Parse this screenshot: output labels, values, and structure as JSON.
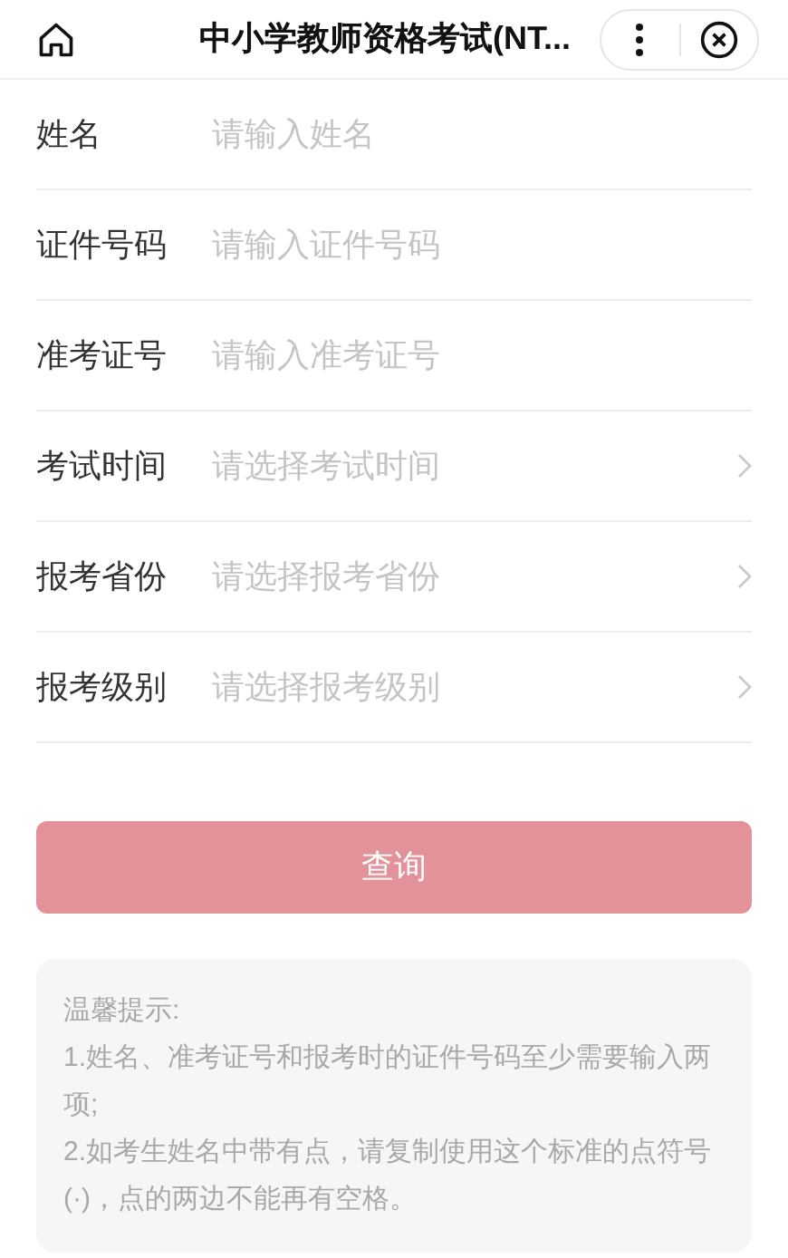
{
  "header": {
    "title": "中小学教师资格考试(NT..."
  },
  "fields": [
    {
      "kind": "input",
      "label": "姓名",
      "placeholder": "请输入姓名"
    },
    {
      "kind": "input",
      "label": "证件号码",
      "placeholder": "请输入证件号码"
    },
    {
      "kind": "input",
      "label": "准考证号",
      "placeholder": "请输入准考证号"
    },
    {
      "kind": "select",
      "label": "考试时间",
      "placeholder": "请选择考试时间"
    },
    {
      "kind": "select",
      "label": "报考省份",
      "placeholder": "请选择报考省份"
    },
    {
      "kind": "select",
      "label": "报考级别",
      "placeholder": "请选择报考级别"
    }
  ],
  "submit": {
    "label": "查询",
    "disabled": true
  },
  "notice": {
    "lines": [
      "温馨提示:",
      "1.姓名、准考证号和报考时的证件号码至少需要输入两项;",
      "2.如考生姓名中带有点，请复制使用这个标准的点符号(·)，点的两边不能再有空格。"
    ]
  }
}
